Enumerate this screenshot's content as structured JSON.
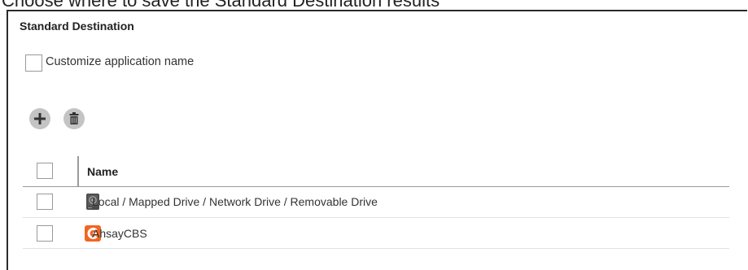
{
  "page_caption": "Choose where to save the Standard Destination results",
  "section": {
    "title": "Standard Destination",
    "customize_label": "Customize application name"
  },
  "toolbar": {
    "add_icon": "plus-icon",
    "delete_icon": "trash-icon"
  },
  "table": {
    "columns": [
      "Name"
    ],
    "rows": [
      {
        "name": "Local / Mapped Drive / Network Drive / Removable Drive",
        "icon": "drive-icon"
      },
      {
        "name": "AhsayCBS",
        "icon": "ahsay-logo-icon"
      }
    ]
  },
  "colors": {
    "accent_orange": "#f26522",
    "button_gray": "#c4c4c4",
    "icon_dark": "#333333"
  }
}
